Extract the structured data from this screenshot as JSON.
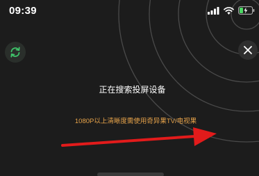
{
  "status_bar": {
    "time": "09:39",
    "icons": [
      "signal-icon",
      "wifi-icon",
      "battery-charging-icon"
    ]
  },
  "main": {
    "searching_label": "正在搜索投屏设备",
    "hint_label": "1080P以上清晰度需使用奇异果TV/电视果"
  },
  "buttons": {
    "refresh_icon": "refresh-icon",
    "close_icon": "close-icon"
  },
  "annotation": {
    "arrow_icon": "red-arrow-right",
    "color": "#e21b1b"
  },
  "colors": {
    "background": "#1c1c1c",
    "accent_green": "#3fc46a",
    "hint_orange": "#e7a34a",
    "battery_green": "#4cd964"
  }
}
